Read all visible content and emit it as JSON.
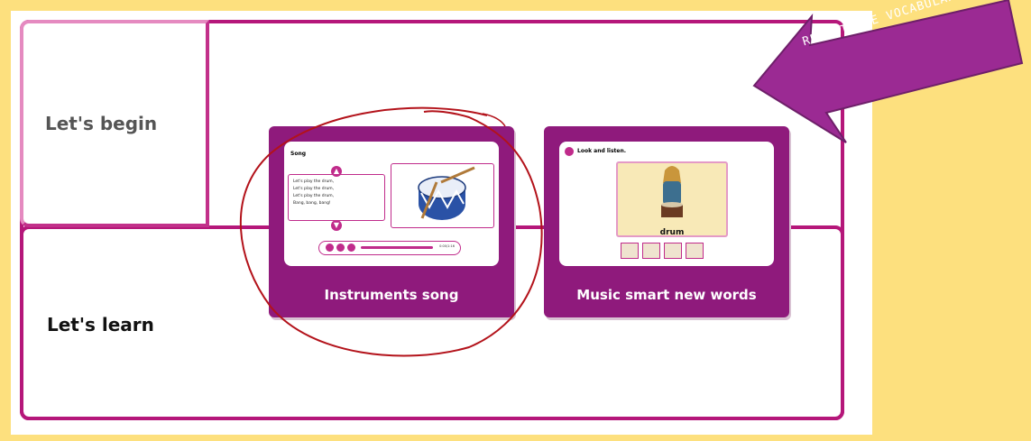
{
  "sections": {
    "begin_label": "Let's begin",
    "learn_label": "Let's learn"
  },
  "cards": [
    {
      "label": "Instruments song",
      "thumb": {
        "title": "Song",
        "lyrics": [
          "Let's play the drum,",
          "Let's play the drum,",
          "Let's play the drum,",
          "Bang, bang, bang!"
        ],
        "time": "0:00/1:16"
      }
    },
    {
      "label": "Music smart new words",
      "thumb": {
        "instruction": "Look and listen.",
        "word": "drum"
      }
    }
  ],
  "annotation": {
    "arrow_text": "REPEAT THE VOCABULARY"
  },
  "colors": {
    "background": "#fde07e",
    "frame": "#b5177a",
    "card": "#8f1a7c",
    "accent": "#c02b8b",
    "note_purple": "#9b2a93",
    "scribble_red": "#b3121a"
  }
}
